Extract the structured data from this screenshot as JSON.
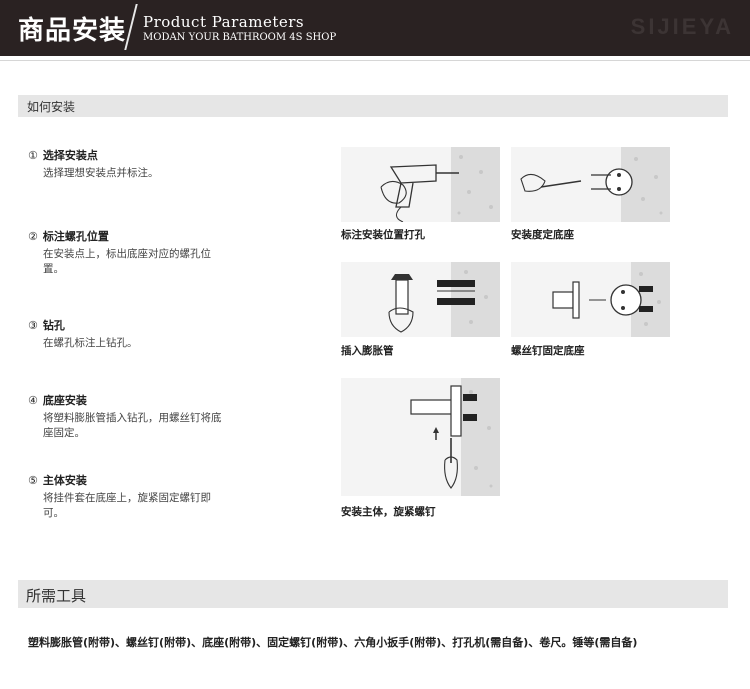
{
  "header": {
    "title": "商品安装",
    "subtitle": "Product Parameters",
    "subtitle2": "MODAN YOUR BATHROOM 4S SHOP",
    "brand": "SIJIEYA"
  },
  "section_install": {
    "label": "如何安装"
  },
  "steps": [
    {
      "num": "①",
      "title": "选择安装点",
      "desc": "选择理想安装点并标注。"
    },
    {
      "num": "②",
      "title": "标注螺孔位置",
      "desc": "在安装点上，标出底座对应的螺孔位置。"
    },
    {
      "num": "③",
      "title": "钻孔",
      "desc": "在螺孔标注上钻孔。"
    },
    {
      "num": "④",
      "title": "底座安装",
      "desc": "将塑料膨胀管插入钻孔，用螺丝钉将底座固定。"
    },
    {
      "num": "⑤",
      "title": "主体安装",
      "desc": "将挂件套在底座上，旋紧固定螺钉即可。"
    }
  ],
  "figures": [
    {
      "caption": "标注安装位置打孔"
    },
    {
      "caption": "安装度定底座"
    },
    {
      "caption": "插入膨胀管"
    },
    {
      "caption": "螺丝钉固定底座"
    },
    {
      "caption": "安装主体，旋紧螺钉"
    }
  ],
  "section_tools": {
    "label": "所需工具"
  },
  "tools_text": "塑料膨胀管(附带)、螺丝钉(附带)、底座(附带)、固定螺钉(附带)、六角小扳手(附带)、打孔机(需自备)、卷尺。锤等(需自备)",
  "colors": {
    "header_bg": "#2a2222",
    "section_bg": "#e6e6e6"
  }
}
